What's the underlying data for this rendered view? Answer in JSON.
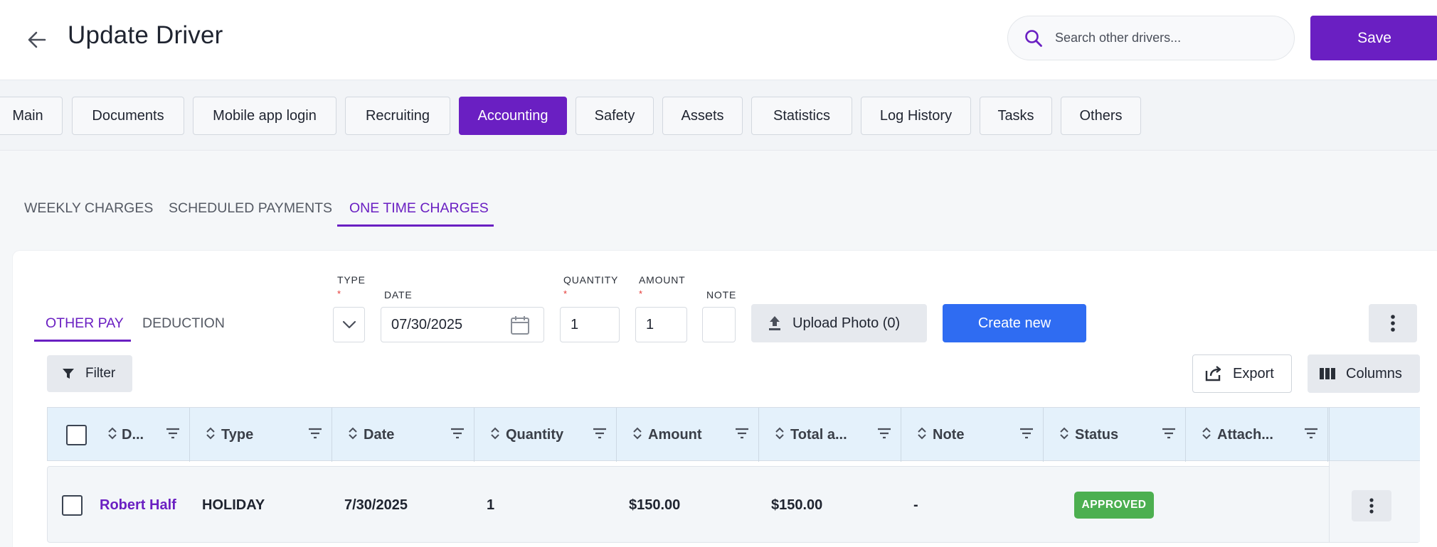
{
  "header": {
    "title": "Update Driver",
    "search_placeholder": "Search other drivers...",
    "save_label": "Save"
  },
  "tabs": [
    {
      "label": "Main",
      "active": false
    },
    {
      "label": "Documents",
      "active": false
    },
    {
      "label": "Mobile app login",
      "active": false
    },
    {
      "label": "Recruiting",
      "active": false
    },
    {
      "label": "Accounting",
      "active": true
    },
    {
      "label": "Safety",
      "active": false
    },
    {
      "label": "Assets",
      "active": false
    },
    {
      "label": "Statistics",
      "active": false
    },
    {
      "label": "Log History",
      "active": false
    },
    {
      "label": "Tasks",
      "active": false
    },
    {
      "label": "Others",
      "active": false
    }
  ],
  "subtabs": [
    {
      "label": "WEEKLY CHARGES",
      "active": false
    },
    {
      "label": "SCHEDULED PAYMENTS",
      "active": false
    },
    {
      "label": "ONE TIME CHARGES",
      "active": true
    }
  ],
  "inner_tabs": [
    {
      "label": "OTHER PAY",
      "active": true
    },
    {
      "label": "DEDUCTION",
      "active": false
    }
  ],
  "form": {
    "type_label": "TYPE",
    "date_label": "DATE",
    "date_value": "07/30/2025",
    "quantity_label": "QUANTITY",
    "quantity_value": "1",
    "amount_label": "AMOUNT",
    "amount_value": "1",
    "note_label": "NOTE",
    "note_value": "",
    "required_mark": "*",
    "upload_label": "Upload Photo (0)",
    "create_label": "Create new"
  },
  "toolbar": {
    "filter_label": "Filter",
    "export_label": "Export",
    "columns_label": "Columns"
  },
  "table": {
    "columns": [
      "D...",
      "Type",
      "Date",
      "Quantity",
      "Amount",
      "Total a...",
      "Note",
      "Status",
      "Attach..."
    ],
    "rows": [
      {
        "driver": "Robert Half",
        "type": "HOLIDAY",
        "date": "7/30/2025",
        "quantity": "1",
        "amount": "$150.00",
        "total": "$150.00",
        "note": "-",
        "status": "APPROVED",
        "attachments": ""
      }
    ]
  },
  "colors": {
    "accent": "#6a1fc2",
    "primary_blue": "#2f6cf2",
    "status_approved": "#4caf50",
    "table_header": "#e4f1fb"
  },
  "icons": [
    "back-arrow-icon",
    "search-icon",
    "chevron-down-icon",
    "calendar-icon",
    "upload-icon",
    "more-vertical-icon",
    "filter-icon",
    "export-icon",
    "columns-icon",
    "sort-icon"
  ]
}
